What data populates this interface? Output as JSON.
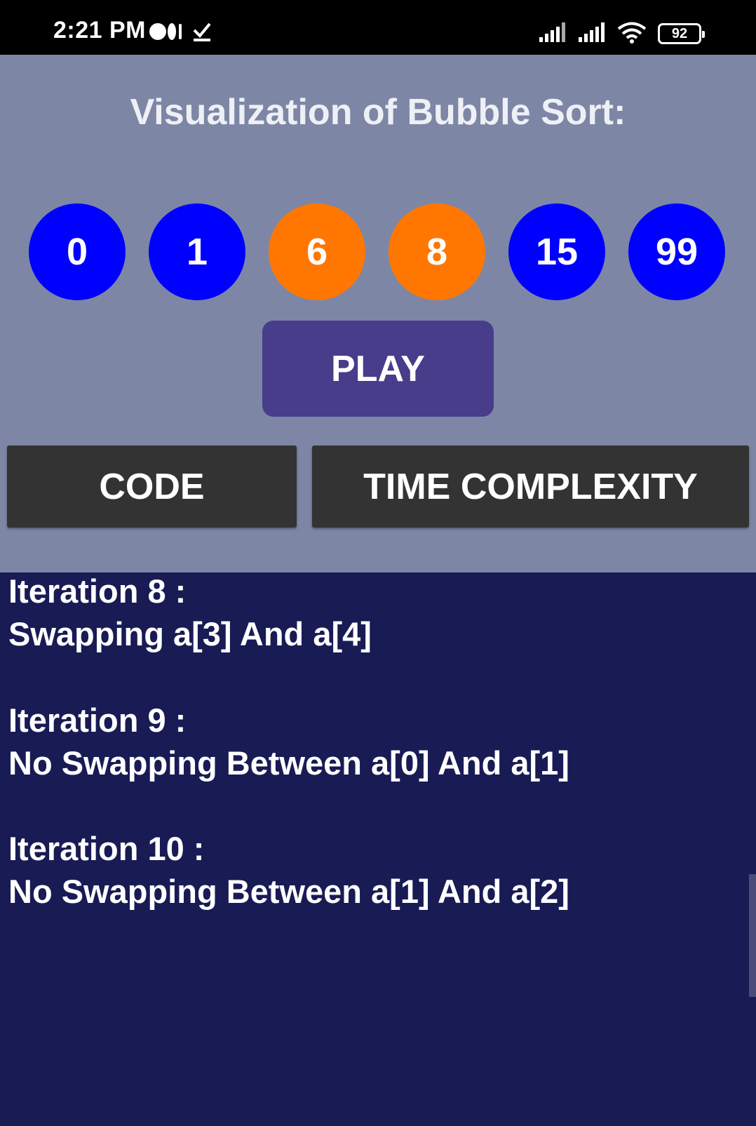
{
  "status_bar": {
    "time": "2:21 PM",
    "battery": "92",
    "icons": [
      "medium-icon",
      "download-done-icon",
      "signal-icon",
      "signal-icon",
      "wifi-icon",
      "battery-icon"
    ]
  },
  "header": {
    "title": "Visualization of Bubble Sort:"
  },
  "array": [
    {
      "value": "0",
      "color": "#0000ff"
    },
    {
      "value": "1",
      "color": "#0000ff"
    },
    {
      "value": "6",
      "color": "#ff7700"
    },
    {
      "value": "8",
      "color": "#ff7700"
    },
    {
      "value": "15",
      "color": "#0000ff"
    },
    {
      "value": "99",
      "color": "#0000ff"
    }
  ],
  "buttons": {
    "play": "PLAY",
    "code": "CODE",
    "time_complexity": "TIME COMPLEXITY"
  },
  "log": [
    {
      "iteration": "Iteration 8 :",
      "action": "Swapping a[3] And a[4]"
    },
    {
      "iteration": "Iteration 9 :",
      "action": "No Swapping Between a[0] And a[1]"
    },
    {
      "iteration": "Iteration 10 :",
      "action": "No Swapping Between a[1] And a[2]"
    }
  ],
  "colors": {
    "top_panel": "#7d87a5",
    "log_background": "#181b54",
    "play_button": "#473d8b",
    "tab_button": "#333333"
  }
}
